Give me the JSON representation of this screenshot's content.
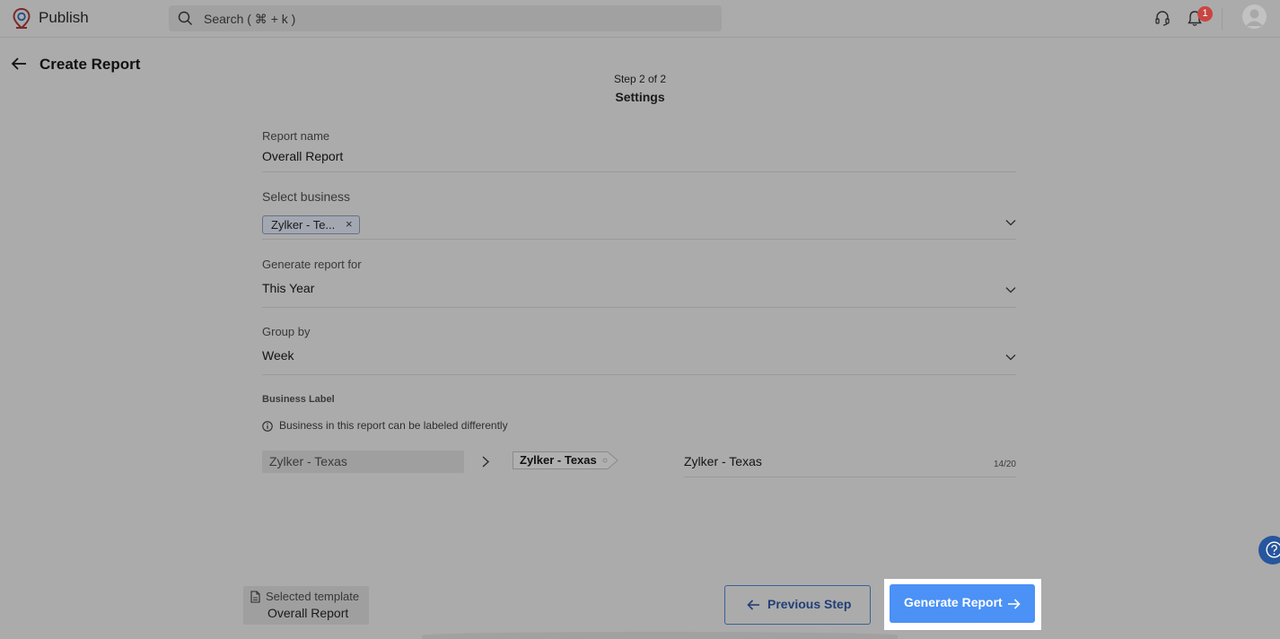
{
  "app": {
    "name": "Publish"
  },
  "search": {
    "placeholder": "Search ( ⌘ + k )"
  },
  "notifications": {
    "count": "1"
  },
  "page": {
    "title": "Create Report",
    "step": "Step 2 of 2",
    "step_name": "Settings"
  },
  "form": {
    "report_name": {
      "label": "Report name",
      "value": "Overall Report"
    },
    "business": {
      "label": "Select business",
      "chip": "Zylker - Te...",
      "chip_remove": "×"
    },
    "period": {
      "label": "Generate report for",
      "value": "This Year"
    },
    "group_by": {
      "label": "Group by",
      "value": "Week"
    }
  },
  "business_label": {
    "heading": "Business Label",
    "info": "Business in this report can be labeled differently",
    "source": "Zylker - Texas",
    "tag": "Zylker - Texas",
    "input": "Zylker - Texas",
    "char_count": "14/20"
  },
  "footer": {
    "template_label": "Selected template",
    "template_value": "Overall Report",
    "prev_label": "Previous Step",
    "generate_label": "Generate Report"
  },
  "colors": {
    "primary": "#4b91f6",
    "badge": "#c84642",
    "overlay": "#ababab"
  },
  "icons": [
    "logo-icon",
    "search-icon",
    "headset-icon",
    "bell-icon",
    "avatar",
    "back-arrow-icon",
    "chevron-down-icon",
    "info-icon",
    "chevron-right-icon",
    "document-icon",
    "arrow-left-icon",
    "arrow-right-icon",
    "help-icon"
  ]
}
